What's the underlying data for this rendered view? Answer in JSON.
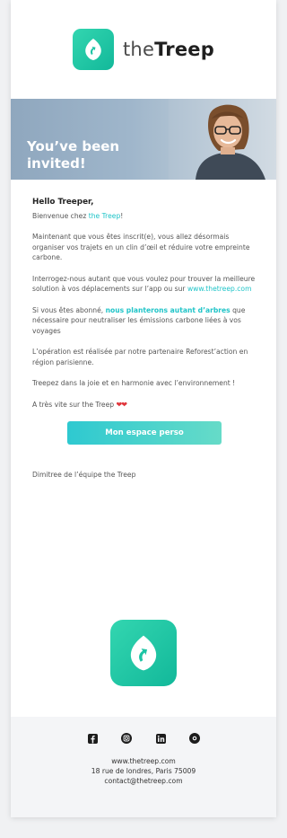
{
  "brand": {
    "name_prefix": "the",
    "name_suffix": "Treep",
    "accent": "#1fc4c8",
    "logo_color": "#1dc4a4"
  },
  "hero": {
    "title": "You’ve been invited!"
  },
  "body": {
    "greeting": "Hello Treeper,",
    "welcome_before": "Bienvenue chez ",
    "welcome_link": "the Treep",
    "welcome_after": "!",
    "p1": "Maintenant que vous êtes inscrit(e), vous allez désormais organiser vos trajets en un clin d’œil et réduire votre empreinte carbone.",
    "p2_before": "Interrogez-nous autant que vous voulez pour trouver la meilleure solution à vos déplacements sur l’app ou sur ",
    "p2_link": "www.thetreep.com",
    "p3_before": "Si vous êtes abonné, ",
    "p3_highlight": "nous planterons autant d’arbres",
    "p3_after": " que nécessaire pour neutraliser les émissions carbone liées à vos voyages",
    "p4": "L’opération est réalisée par notre partenaire Reforest’action en région parisienne.",
    "p5": "Treepez dans la joie et en harmonie avec l’environnement !",
    "p6": "A très vite sur the Treep ",
    "hearts": "❤❤",
    "cta_label": "Mon espace perso",
    "signature": "Dimitree de l’équipe the Treep"
  },
  "footer": {
    "social_icons": [
      "facebook-icon",
      "instagram-icon",
      "linkedin-icon",
      "medium-icon"
    ],
    "website": "www.thetreep.com",
    "address": "18 rue de londres, Paris 75009",
    "email": "contact@thetreep.com"
  }
}
